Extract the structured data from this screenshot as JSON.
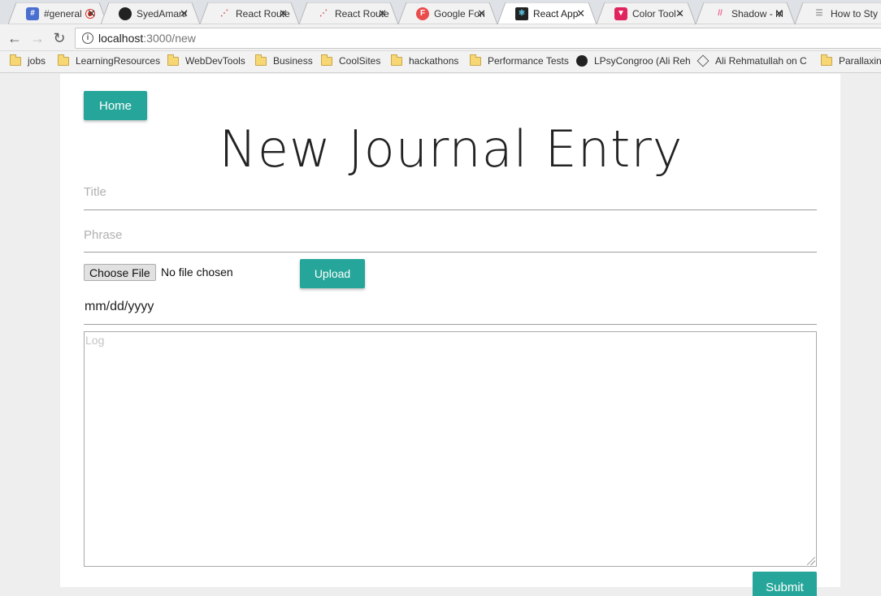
{
  "tabs": [
    {
      "title": "#general",
      "favicon": "slack-icon",
      "recording": true,
      "active": false
    },
    {
      "title": "SyedAman/",
      "favicon": "github-icon",
      "active": false
    },
    {
      "title": "React Route",
      "favicon": "react-router-icon",
      "active": false
    },
    {
      "title": "React Route",
      "favicon": "react-router-icon",
      "active": false
    },
    {
      "title": "Google Fon",
      "favicon": "google-fonts-icon",
      "active": false
    },
    {
      "title": "React App",
      "favicon": "react-icon",
      "active": true
    },
    {
      "title": "Color Tool -",
      "favicon": "color-tool-icon",
      "active": false
    },
    {
      "title": "Shadow - M",
      "favicon": "material-icon",
      "active": false
    },
    {
      "title": "How to Sty",
      "favicon": "document-icon",
      "active": false
    }
  ],
  "address": {
    "host": "localhost",
    "path": ":3000/new"
  },
  "bookmarks": [
    {
      "label": "jobs",
      "icon": "folder-icon"
    },
    {
      "label": "LearningResources",
      "icon": "folder-icon"
    },
    {
      "label": "WebDevTools",
      "icon": "folder-icon"
    },
    {
      "label": "Business",
      "icon": "folder-icon"
    },
    {
      "label": "CoolSites",
      "icon": "folder-icon"
    },
    {
      "label": "hackathons",
      "icon": "folder-icon"
    },
    {
      "label": "Performance Tests",
      "icon": "folder-icon"
    },
    {
      "label": "LPsyCongroo (Ali Reh",
      "icon": "github-icon"
    },
    {
      "label": "Ali Rehmatullah on C",
      "icon": "codepen-icon"
    },
    {
      "label": "Parallaxing",
      "icon": "folder-icon"
    }
  ],
  "page": {
    "home_label": "Home",
    "heading": "New Journal Entry",
    "title_placeholder": "Title",
    "phrase_placeholder": "Phrase",
    "choose_file_label": "Choose File",
    "no_file_text": "No file chosen",
    "upload_label": "Upload",
    "date_value": "mm/dd/yyyy",
    "log_placeholder": "Log",
    "submit_label": "Submit"
  },
  "colors": {
    "accent": "#26a69a",
    "page_bg": "#ffffff",
    "outer_bg": "#eeeeee"
  }
}
